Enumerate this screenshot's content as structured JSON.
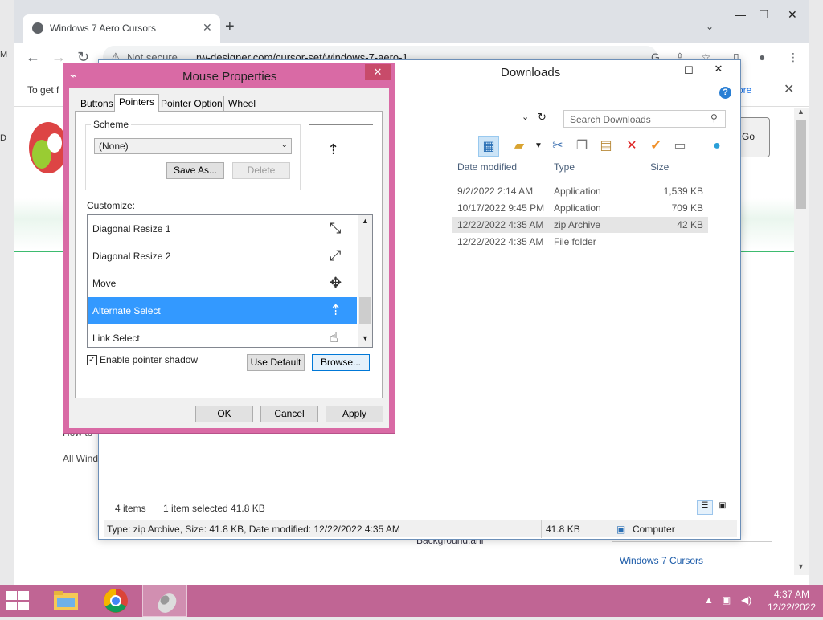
{
  "browser": {
    "tab_title": "Windows 7 Aero Cursors",
    "omnibox_status": "Not secure",
    "url": "rw-designer.com/cursor-set/windows-7-aero-1",
    "infobar_text": "To get f",
    "infobar_link": "n more",
    "go_button": "Go",
    "side_links": [
      "How to",
      "All Wind"
    ],
    "bottom_link": "Background.ani",
    "related_link": "Windows 7 Cursors"
  },
  "explorer": {
    "title": "Downloads",
    "search_placeholder": "Search Downloads",
    "columns": [
      "Date modified",
      "Type",
      "Size"
    ],
    "files": [
      {
        "date": "9/2/2022 2:14 AM",
        "type": "Application",
        "size": "1,539 KB"
      },
      {
        "date": "10/17/2022 9:45 PM",
        "type": "Application",
        "size": "709 KB"
      },
      {
        "date": "12/22/2022 4:35 AM",
        "type": "zip Archive",
        "size": "42 KB"
      },
      {
        "date": "12/22/2022 4:35 AM",
        "type": "File folder",
        "size": ""
      }
    ],
    "items_count": "4 items",
    "selection": "1 item selected  41.8 KB",
    "details": "Type: zip Archive, Size: 41.8 KB, Date modified: 12/22/2022 4:35 AM",
    "details_size": "41.8 KB",
    "location": "Computer"
  },
  "dialog": {
    "title": "Mouse Properties",
    "tabs": [
      "Buttons",
      "Pointers",
      "Pointer Options",
      "Wheel"
    ],
    "scheme_label": "Scheme",
    "scheme_value": "(None)",
    "save_as": "Save As...",
    "delete": "Delete",
    "customize_label": "Customize:",
    "pointers": [
      {
        "name": "Diagonal Resize 1",
        "icon": "diagonal-resize-1-icon",
        "glyph": "⤡"
      },
      {
        "name": "Diagonal Resize 2",
        "icon": "diagonal-resize-2-icon",
        "glyph": "⤢"
      },
      {
        "name": "Move",
        "icon": "move-icon",
        "glyph": "✥"
      },
      {
        "name": "Alternate Select",
        "icon": "alternate-select-icon",
        "glyph": "⇡"
      },
      {
        "name": "Link Select",
        "icon": "hand-pointer-icon",
        "glyph": "☝"
      }
    ],
    "shadow_label": "Enable pointer shadow",
    "shadow_checked": true,
    "use_default": "Use Default",
    "browse": "Browse...",
    "ok": "OK",
    "cancel": "Cancel",
    "apply": "Apply"
  },
  "taskbar": {
    "time": "4:37 AM",
    "date": "12/22/2022",
    "accent": "#c06594"
  }
}
